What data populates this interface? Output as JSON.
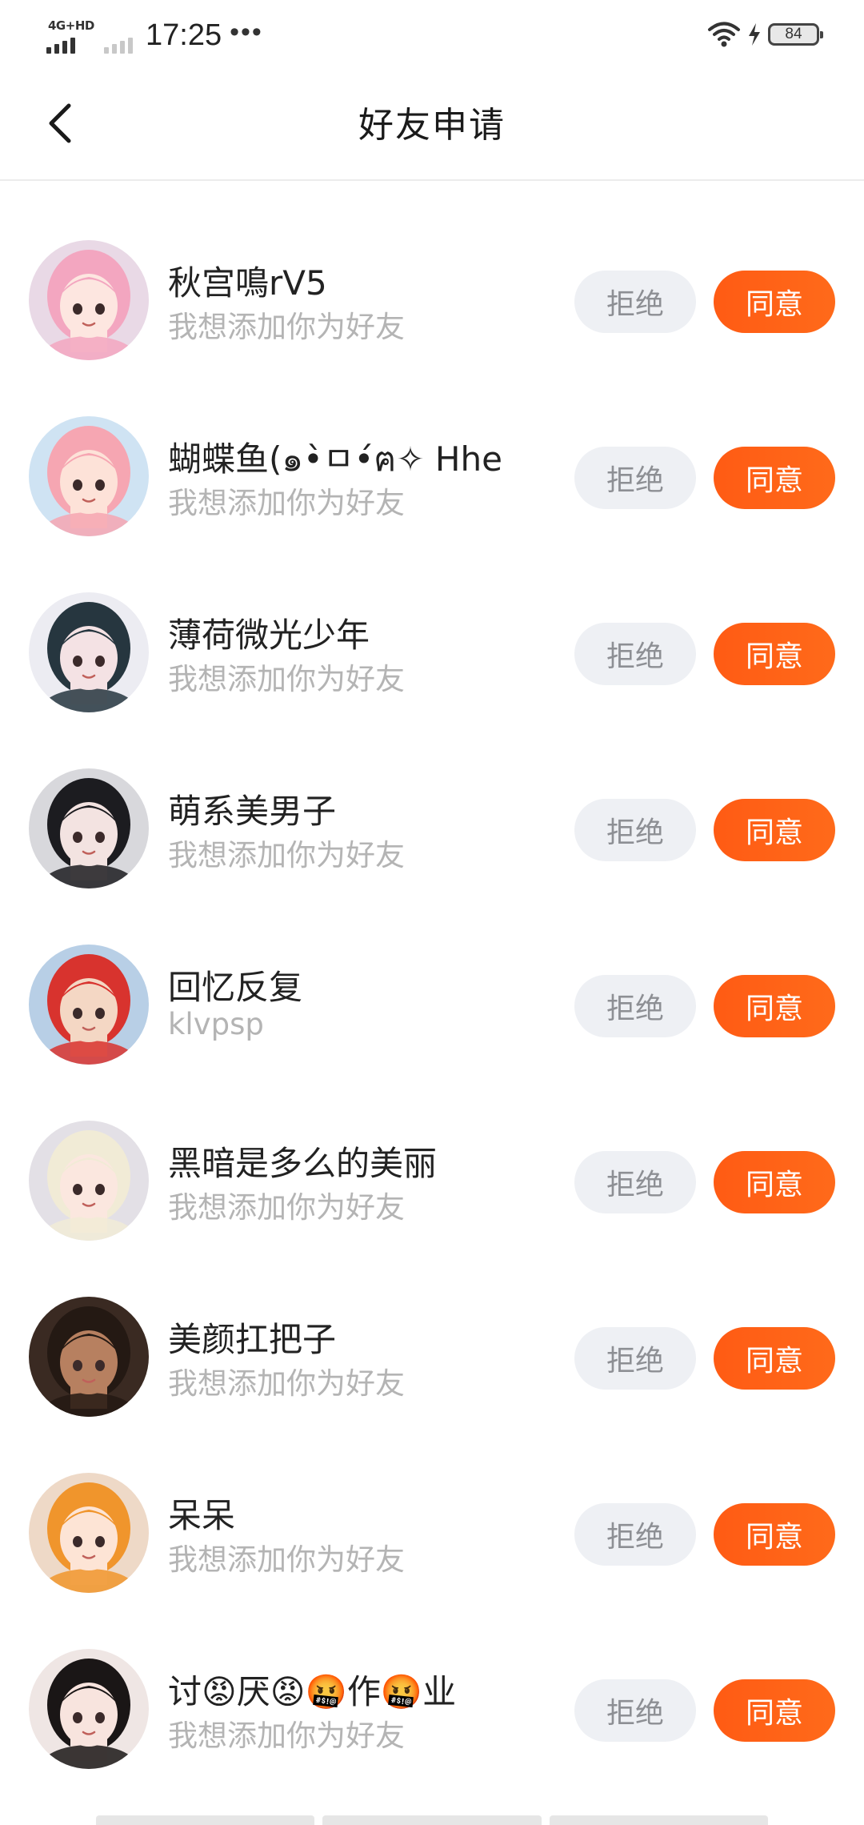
{
  "status_bar": {
    "network": "4G+HD",
    "time": "17:25",
    "more": "•••",
    "battery": "84"
  },
  "header": {
    "title": "好友申请"
  },
  "requests": [
    {
      "name": "秋宫鳴rV5",
      "subtitle": "我想添加你为好友",
      "reject_label": "拒绝",
      "accept_label": "同意"
    },
    {
      "name": "蝴蝶鱼(๑•̀ㅁ•́ฅ✧ Hhe",
      "subtitle": "我想添加你为好友",
      "reject_label": "拒绝",
      "accept_label": "同意"
    },
    {
      "name": "薄荷微光少年",
      "subtitle": "我想添加你为好友",
      "reject_label": "拒绝",
      "accept_label": "同意"
    },
    {
      "name": "萌系美男子",
      "subtitle": "我想添加你为好友",
      "reject_label": "拒绝",
      "accept_label": "同意"
    },
    {
      "name": "回忆反复",
      "subtitle": "klvpsp",
      "reject_label": "拒绝",
      "accept_label": "同意"
    },
    {
      "name": "黑暗是多么的美丽",
      "subtitle": "我想添加你为好友",
      "reject_label": "拒绝",
      "accept_label": "同意"
    },
    {
      "name": "美颜扛把子",
      "subtitle": "我想添加你为好友",
      "reject_label": "拒绝",
      "accept_label": "同意"
    },
    {
      "name": "呆呆",
      "subtitle": "我想添加你为好友",
      "reject_label": "拒绝",
      "accept_label": "同意"
    },
    {
      "name": "讨😡厌😡🤬作🤬业",
      "subtitle": "我想添加你为好友",
      "reject_label": "拒绝",
      "accept_label": "同意"
    }
  ],
  "colors": {
    "accept": "#ff5b14",
    "reject_bg": "#eef0f4",
    "subtitle": "#b4b4b4"
  },
  "avatars": [
    {
      "bg": "#e9d9e6",
      "hair": "#f3a6c0",
      "skin": "#fde6e0",
      "icon": "anime-girl-pink-hair"
    },
    {
      "bg": "#cfe3f3",
      "hair": "#f6a6b2",
      "skin": "#fde2d8",
      "icon": "anime-girl-glasses"
    },
    {
      "bg": "#ececf2",
      "hair": "#26363f",
      "skin": "#f4e2e4",
      "icon": "anime-boy-dark-hair"
    },
    {
      "bg": "#d8d8dc",
      "hair": "#1c1c20",
      "skin": "#f3e3e1",
      "icon": "anime-girl-black-hair"
    },
    {
      "bg": "#b8cfe6",
      "hair": "#d8332e",
      "skin": "#f4d7c4",
      "icon": "anime-boy-red-cap"
    },
    {
      "bg": "#e3e0e6",
      "hair": "#f1ebd6",
      "skin": "#fbe7df",
      "icon": "anime-girl-cat-ears"
    },
    {
      "bg": "#3a2a22",
      "hair": "#241913",
      "skin": "#b78060",
      "icon": "realistic-girl-portrait"
    },
    {
      "bg": "#eed9c7",
      "hair": "#f0952c",
      "skin": "#fde4d5",
      "icon": "anime-girl-orange-hair"
    },
    {
      "bg": "#efe6e4",
      "hair": "#1a1616",
      "skin": "#f8e4de",
      "icon": "anime-girl-glasses-black-hair"
    }
  ]
}
